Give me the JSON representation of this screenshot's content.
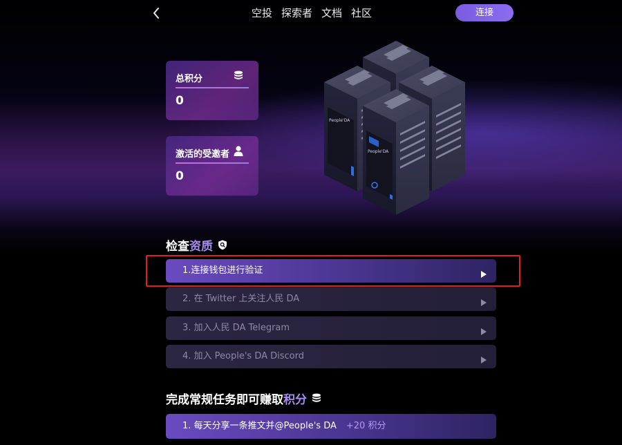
{
  "nav": {
    "items": [
      "空投",
      "探索者",
      "文档",
      "社区"
    ],
    "connect_label": "连接"
  },
  "stats": {
    "total_points": {
      "label": "总积分",
      "value": "0",
      "icon": "coins-stack-icon"
    },
    "active_invitees": {
      "label": "激活的受邀者",
      "value": "0",
      "icon": "user-icon"
    }
  },
  "illustration": {
    "server_labels": [
      "People'DA",
      "People'DA"
    ]
  },
  "eligibility": {
    "title_prefix": "检查",
    "title_accent": "资质",
    "title_icon": "shield-search-icon",
    "steps": [
      {
        "label": "1.连接钱包进行验证",
        "active": true
      },
      {
        "label": "2. 在 Twitter 上关注人民 DA",
        "active": false
      },
      {
        "label": "3. 加入人民 DA Telegram",
        "active": false
      },
      {
        "label": "4. 加入 People's DA Discord",
        "active": false
      }
    ]
  },
  "tasks": {
    "title_prefix": "完成常规任务即可赚取",
    "title_accent": "积分",
    "title_icon": "coins-stack-icon",
    "items": [
      {
        "label": "1. 每天分享一条推文并@People's DA",
        "points": "+20 积分"
      }
    ]
  },
  "colors": {
    "accent": "#8c6cf0",
    "accent_text": "#a98cf2",
    "highlight": "#e02020"
  }
}
